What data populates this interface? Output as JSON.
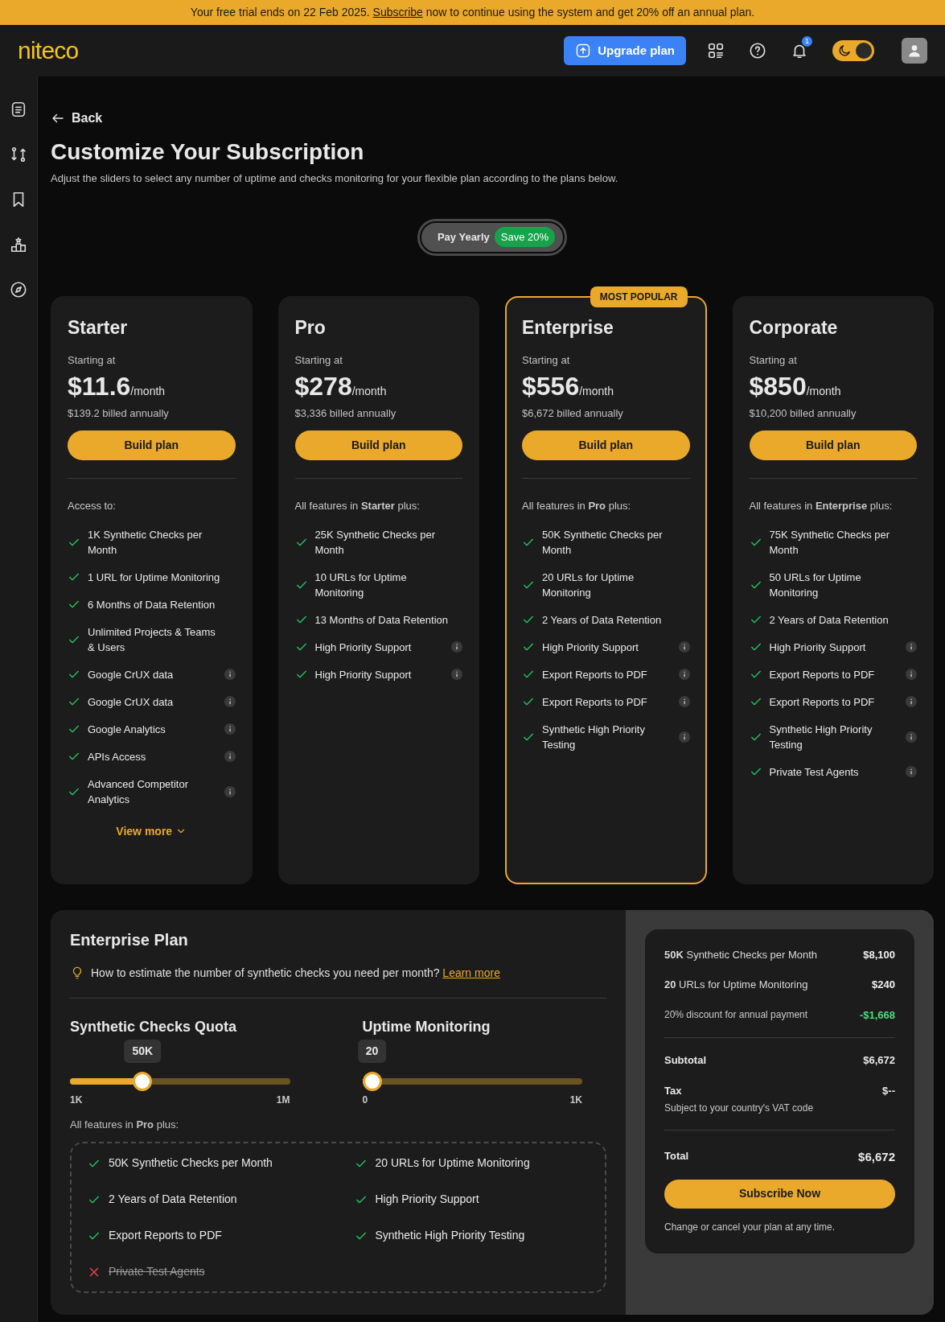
{
  "banner": {
    "before": "Your free trial ends on 22 Feb 2025.",
    "link": "Subscribe",
    "after": "now to continue using the system and get 20% off an annual plan."
  },
  "header": {
    "logo": "niteco",
    "upgrade": "Upgrade plan",
    "notifications": "1",
    "dark_mode": true
  },
  "back": "Back",
  "title": "Customize Your Subscription",
  "subtitle": "Adjust the sliders to select any number of uptime and checks monitoring for your flexible plan according to the plans below.",
  "billing": {
    "label": "Pay Yearly",
    "badge": "Save 20%"
  },
  "plans": [
    {
      "name": "Starter",
      "popular": false,
      "starting": "Starting at",
      "price": "$11.6",
      "per": "/month",
      "billed": "$139.2 billed annually",
      "button": "Build plan",
      "intro": "Access to:",
      "features": [
        {
          "text": "1K Synthetic Checks per Month",
          "info": false
        },
        {
          "text": "1 URL for Uptime Monitoring",
          "info": false
        },
        {
          "text": "6 Months of Data Retention",
          "info": false
        },
        {
          "text": "Unlimited Projects & Teams & Users",
          "info": false
        },
        {
          "text": "Google CrUX data",
          "info": true
        },
        {
          "text": "Google CrUX data",
          "info": true
        },
        {
          "text": "Google Analytics",
          "info": true
        },
        {
          "text": "APIs Access",
          "info": true
        },
        {
          "text": "Advanced Competitor Analytics",
          "info": true
        }
      ],
      "more": "View more"
    },
    {
      "name": "Pro",
      "popular": false,
      "starting": "Starting at",
      "price": "$278",
      "per": "/month",
      "billed": "$3,336 billed annually",
      "button": "Build plan",
      "intro": "All features in **Starter** plus:",
      "features": [
        {
          "text": "25K Synthetic Checks per Month",
          "info": false
        },
        {
          "text": "10 URLs for Uptime Monitoring",
          "info": false
        },
        {
          "text": "13 Months of Data Retention",
          "info": false
        },
        {
          "text": "High Priority Support",
          "info": true
        },
        {
          "text": "High Priority Support",
          "info": true
        }
      ]
    },
    {
      "name": "Enterprise",
      "popular": true,
      "badge": "MOST POPULAR",
      "starting": "Starting at",
      "price": "$556",
      "per": "/month",
      "billed": "$6,672 billed annually",
      "button": "Build plan",
      "intro": "All features in **Pro** plus:",
      "features": [
        {
          "text": "50K Synthetic Checks per Month",
          "info": false
        },
        {
          "text": "20 URLs for Uptime Monitoring",
          "info": false
        },
        {
          "text": "2 Years of Data Retention",
          "info": false
        },
        {
          "text": "High Priority Support",
          "info": true
        },
        {
          "text": "Export Reports to PDF",
          "info": true
        },
        {
          "text": "Export Reports to PDF",
          "info": true
        },
        {
          "text": "Synthetic High Priority Testing",
          "info": true
        }
      ]
    },
    {
      "name": "Corporate",
      "popular": false,
      "starting": "Starting at",
      "price": "$850",
      "per": "/month",
      "billed": "$10,200 billed annually",
      "button": "Build plan",
      "intro": "All features in **Enterprise** plus:",
      "features": [
        {
          "text": "75K Synthetic Checks per Month",
          "info": false
        },
        {
          "text": "50 URLs for Uptime Monitoring",
          "info": false
        },
        {
          "text": "2 Years of Data Retention",
          "info": false
        },
        {
          "text": "High Priority Support",
          "info": true
        },
        {
          "text": "Export Reports to PDF",
          "info": true
        },
        {
          "text": "Export Reports to PDF",
          "info": true
        },
        {
          "text": "Synthetic High Priority Testing",
          "info": true
        },
        {
          "text": "Private Test Agents",
          "info": true
        }
      ]
    }
  ],
  "builder": {
    "title": "Enterprise Plan",
    "tip": "How to estimate the number of synthetic checks you need per month?",
    "tip_link": "Learn more",
    "sliders": [
      {
        "title": "Synthetic Checks Quota",
        "value": "50K",
        "level": 0.33,
        "min": "1K",
        "max": "1M"
      },
      {
        "title": "Uptime Monitoring",
        "value": "20",
        "level": 0.04,
        "min": "0",
        "max": "1K"
      }
    ],
    "intro": "All features in **Pro** plus:",
    "features": [
      {
        "text": "50K Synthetic Checks per Month",
        "included": true
      },
      {
        "text": "20 URLs for Uptime Monitoring",
        "included": true
      },
      {
        "text": "2 Years of Data Retention",
        "included": true
      },
      {
        "text": "High Priority Support",
        "included": true
      },
      {
        "text": "Export Reports to PDF",
        "included": true
      },
      {
        "text": "Synthetic High Priority Testing",
        "included": true
      },
      {
        "text": "Private Test Agents",
        "included": false
      }
    ]
  },
  "summary": {
    "lines": [
      {
        "label": "**50K** Synthetic Checks per Month",
        "amount": "$8,100",
        "kind": "charge"
      },
      {
        "label": "**20** URLs for Uptime Monitoring",
        "amount": "$240",
        "kind": "charge"
      },
      {
        "label": "20% discount for annual payment",
        "amount": "-$1,668",
        "kind": "discount"
      }
    ],
    "subtotal": {
      "label": "Subtotal",
      "amount": "$6,672"
    },
    "tax": {
      "label": "Tax",
      "note": "Subject to your country's VAT code",
      "amount": "$--"
    },
    "total": {
      "label": "Total",
      "amount": "$6,672"
    },
    "button": "Subscribe Now",
    "footnote": "Change or cancel your plan at any time."
  }
}
